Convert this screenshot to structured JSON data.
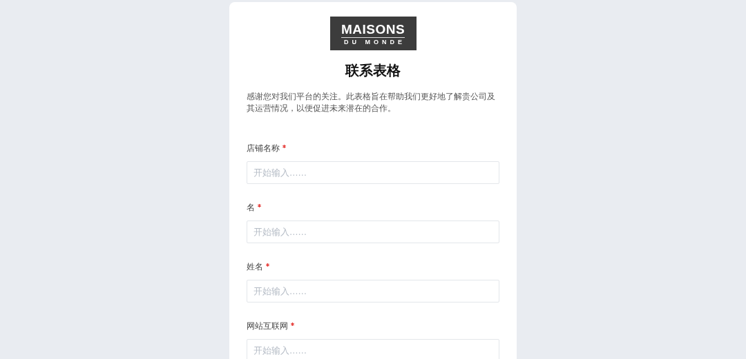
{
  "logo": {
    "line_1": "MAISONS",
    "line_2": "DU MONDE"
  },
  "title": "联系表格",
  "description": "感谢您对我们平台的关注。此表格旨在帮助我们更好地了解贵公司及其运营情况，以便促进未来潜在的合作。",
  "fields": [
    {
      "label": "店铺名称",
      "required": true,
      "placeholder": "开始输入……"
    },
    {
      "label": "名",
      "required": true,
      "placeholder": "开始输入……"
    },
    {
      "label": "姓名",
      "required": true,
      "placeholder": "开始输入……"
    },
    {
      "label": "网站互联网",
      "required": true,
      "placeholder": "开始输入……"
    }
  ]
}
